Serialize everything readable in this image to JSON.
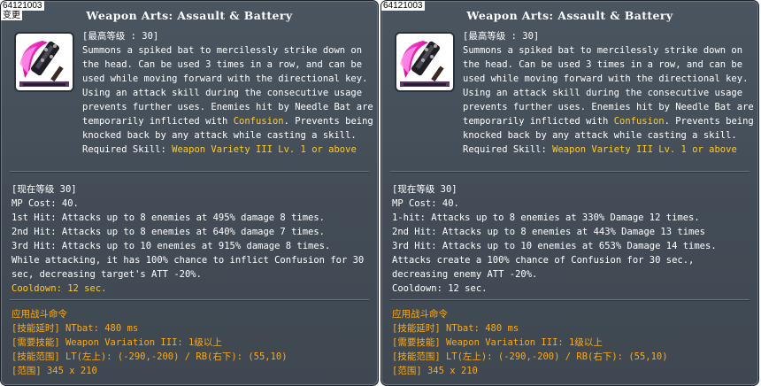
{
  "panels": [
    {
      "id_tag": "64121003",
      "change_tag": "变更",
      "title": "Weapon Arts: Assault & Battery",
      "max_level": "[最高等级 : 30]",
      "description_segments": [
        "Summons a spiked bat to mercilessly strike down on the head. Can be used 3 times in a row, and can be used while moving forward with the directional key. Using an attack skill during the consecutive usage prevents further uses. Enemies hit by Needle Bat are temporarily inflicted with ",
        "Confusion",
        ". Prevents being knocked back by any attack while casting a skill."
      ],
      "required_skill_label": "Required Skill: ",
      "required_skill_value": "Weapon Variety III Lv. 1 or above",
      "current_level": "[现在等级 30]",
      "stats": [
        "MP Cost: 40.",
        "1st Hit: Attacks up to 8 enemies at 495% damage 8 times.",
        "2nd Hit: Attacks up to 8 enemies at 640% damage 7 times.",
        "3rd Hit: Attacks up to 10 enemies at 915% damage 8 times.",
        "While attacking, it has 100% chance to inflict Confusion for 30 sec, decreasing target's ATT -20%."
      ],
      "cooldown": "Cooldown: 12 sec.",
      "battle_header": "应用战斗命令",
      "battle_lines": [
        "[技能延时] NTbat: 480 ms",
        "[需要技能] Weapon Variation III: 1级以上",
        "[技能范围] LT(左上): (-290,-200) / RB(右下): (55,10)",
        "[范围] 345 x 210"
      ]
    },
    {
      "id_tag": "64121003",
      "title": "Weapon Arts: Assault & Battery",
      "max_level": "[最高等级 : 30]",
      "description_segments": [
        "Summons a spiked bat to mercilessly strike down on the head. Can be used 3 times in a row, and can be used while moving forward with the directional key. Using an attack skill during the consecutive usage prevents further uses. Enemies hit by Needle Bat are temporarily inflicted with ",
        "Confusion",
        ". Prevents being knocked back by any attack while casting a skill."
      ],
      "required_skill_label": "Required Skill: ",
      "required_skill_value": "Weapon Variety III Lv. 1 or above",
      "current_level": "[现在等级 30]",
      "stats": [
        "MP Cost: 40.",
        "1-hit: Attacks up to 8 enemies at 330% Damage 12 times.",
        "2nd Hit: Attacks up to 8 enemies at 443% Damage 13 times",
        "3rd Hit: Attacks up to 10 enemies at 653% Damage 14 times.",
        "Attacks create a 100% chance of Confusion for 30 sec., decreasing enemy ATT -20%.",
        "Cooldown: 12 sec."
      ],
      "battle_header": "应用战斗命令",
      "battle_lines": [
        "[技能延时] NTbat: 480 ms",
        "[需要技能] Weapon Variation III: 1级以上",
        "[技能范围] LT(左上): (-290,-200) / RB(右下): (55,10)",
        "[范围] 345 x 210"
      ]
    }
  ],
  "colors": {
    "panel_bg": "#454e58",
    "text": "#ffffff",
    "highlight_yellow": "#ffcc22",
    "highlight_orange": "#ffaa11"
  },
  "icons": [
    "skill-icon-spiked-bat"
  ]
}
